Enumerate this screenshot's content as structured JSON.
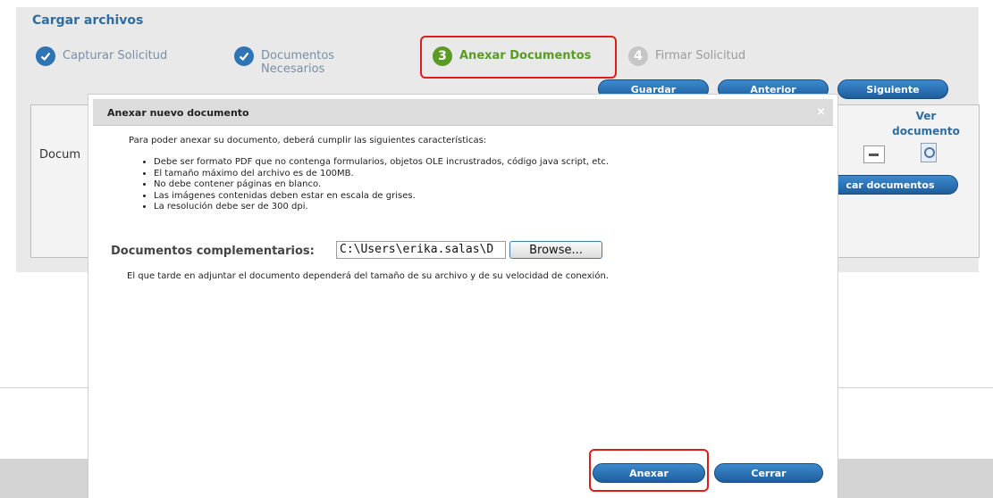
{
  "page": {
    "section_title": "Cargar archivos",
    "steps": [
      {
        "number": "",
        "label_line1": "Capturar Solicitud",
        "label_line2": "",
        "state": "done"
      },
      {
        "number": "",
        "label_line1": "Documentos",
        "label_line2": "Necesarios",
        "state": "done"
      },
      {
        "number": "3",
        "label_line1": "Anexar Documentos",
        "label_line2": "",
        "state": "active"
      },
      {
        "number": "4",
        "label_line1": "Firmar Solicitud",
        "label_line2": "",
        "state": "todo"
      }
    ],
    "nav_buttons": {
      "save": "Guardar",
      "previous": "Anterior",
      "next": "Siguiente"
    },
    "background": {
      "field_label": "Docum",
      "ver_documento": "Ver documento",
      "load_docs_button": "car documentos"
    }
  },
  "dialog": {
    "title": "Anexar nuevo documento",
    "close_symbol": "×",
    "intro": "Para poder anexar su documento, deberá cumplir las siguientes características:",
    "requirements": [
      "Debe ser formato PDF que no contenga formularios, objetos OLE incrustrados, código java script, etc.",
      "El tamaño máximo del archivo es de 100MB.",
      "No debe contener páginas en blanco.",
      "Las imágenes contenidas deben estar en escala de grises.",
      "La resolución debe ser de 300 dpi."
    ],
    "upload_label": "Documentos complementarios:",
    "file_value": "C:\\Users\\erika.salas\\D",
    "browse_label": "Browse...",
    "hint": "El que tarde en adjuntar el documento dependerá del tamaño de su archivo y de su velocidad de conexión.",
    "attach_label": "Anexar",
    "close_label": "Cerrar"
  },
  "colors": {
    "accent_blue": "#2f74b5",
    "active_green": "#5a9b25",
    "highlight_red": "#e01c1c"
  }
}
